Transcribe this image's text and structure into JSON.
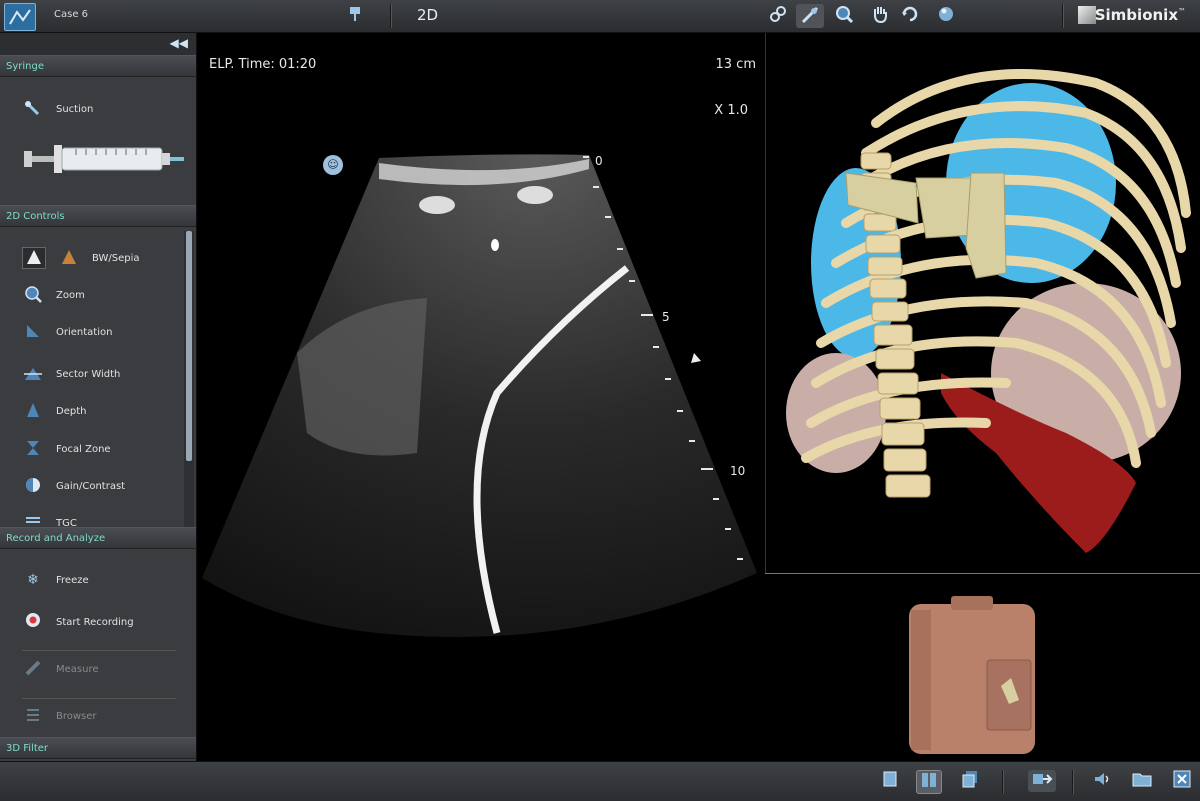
{
  "topbar": {
    "case_label": "Case 6",
    "mode": "2D",
    "brand": "Simbionix",
    "brand_mark": "™",
    "tools": [
      "link-icon",
      "needle-guide-icon",
      "magnify-icon",
      "hand-pan-icon",
      "rotate-icon",
      "view-sphere-icon"
    ]
  },
  "sidebar": {
    "syringe": {
      "header": "Syringe",
      "suction_label": "Suction"
    },
    "controls": {
      "header": "2D Controls",
      "bw_sepia": "BW/Sepia",
      "zoom": "Zoom",
      "orientation": "Orientation",
      "sector_width": "Sector Width",
      "depth": "Depth",
      "focal_zone": "Focal Zone",
      "gain_contrast": "Gain/Contrast",
      "tgc": "TGC"
    },
    "record": {
      "header": "Record and Analyze",
      "freeze": "Freeze",
      "start_recording": "Start Recording",
      "measure": "Measure",
      "browser": "Browser"
    },
    "filter": {
      "header": "3D Filter"
    }
  },
  "ultrasound": {
    "elp_time": "ELP. Time: 01:20",
    "depth_cm": "13 cm",
    "zoom_factor": "X 1.0",
    "depth_ticks": [
      "0",
      "5",
      "10"
    ]
  },
  "colors": {
    "accent": "#7fdcc8",
    "toolbar": "#2b2d30",
    "bone": "#e8d7a9",
    "lung": "#4bb8e8",
    "heart": "#c9aea8",
    "liver": "#9c1b1b",
    "probe": "#d8cfa0",
    "mannequin": "#b9816a"
  }
}
